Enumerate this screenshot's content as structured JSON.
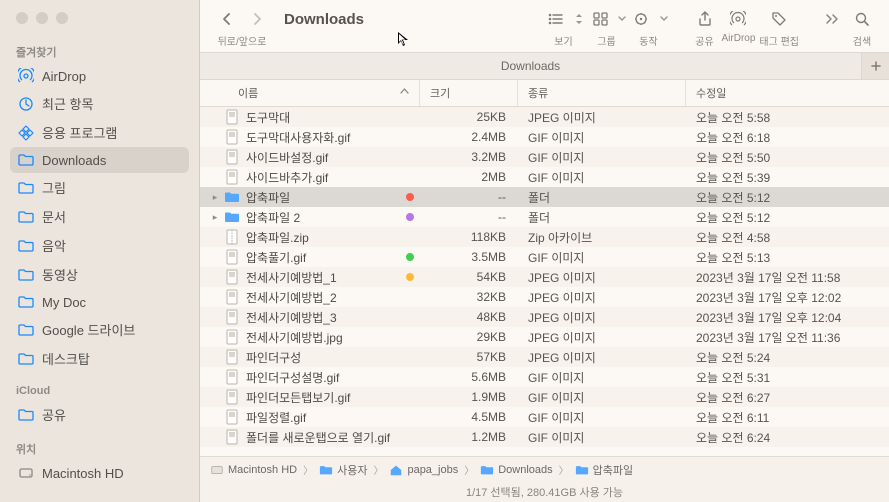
{
  "sidebar": {
    "sections": [
      {
        "title": "즐겨찾기",
        "items": [
          {
            "label": "AirDrop",
            "icon": "airdrop",
            "active": false
          },
          {
            "label": "최근 항목",
            "icon": "clock",
            "active": false
          },
          {
            "label": "응용 프로그램",
            "icon": "apps",
            "active": false
          },
          {
            "label": "Downloads",
            "icon": "folder",
            "active": true
          },
          {
            "label": "그림",
            "icon": "folder",
            "active": false
          },
          {
            "label": "문서",
            "icon": "folder",
            "active": false
          },
          {
            "label": "음악",
            "icon": "folder",
            "active": false
          },
          {
            "label": "동영상",
            "icon": "folder",
            "active": false
          },
          {
            "label": "My Doc",
            "icon": "folder",
            "active": false
          },
          {
            "label": "Google 드라이브",
            "icon": "folder",
            "active": false
          },
          {
            "label": "데스크탑",
            "icon": "folder",
            "active": false
          }
        ]
      },
      {
        "title": "iCloud",
        "items": [
          {
            "label": "공유",
            "icon": "folder",
            "active": false
          }
        ]
      },
      {
        "title": "위치",
        "items": [
          {
            "label": "Macintosh HD",
            "icon": "disk",
            "active": false
          }
        ]
      }
    ]
  },
  "toolbar": {
    "back_forward_label": "뒤로/앞으로",
    "title": "Downloads",
    "view_label": "보기",
    "group_label": "그룹",
    "action_label": "동작",
    "share_label": "공유",
    "airdrop_label": "AirDrop",
    "tagedit_label": "태그 편집",
    "search_label": "검색"
  },
  "tabs": {
    "current": "Downloads"
  },
  "columns": {
    "name": "이름",
    "size": "크기",
    "kind": "종류",
    "date": "수정일"
  },
  "rows": [
    {
      "name": "도구막대",
      "icon": "img",
      "size": "25KB",
      "kind": "JPEG 이미지",
      "date": "오늘 오전 5:58"
    },
    {
      "name": "도구막대사용자화.gif",
      "icon": "img",
      "size": "2.4MB",
      "kind": "GIF 이미지",
      "date": "오늘 오전 6:18"
    },
    {
      "name": "사이드바설정.gif",
      "icon": "img",
      "size": "3.2MB",
      "kind": "GIF 이미지",
      "date": "오늘 오전 5:50"
    },
    {
      "name": "사이드바추가.gif",
      "icon": "img",
      "size": "2MB",
      "kind": "GIF 이미지",
      "date": "오늘 오전 5:39"
    },
    {
      "name": "압축파일",
      "icon": "folder",
      "disclose": true,
      "selected": true,
      "tag": "#ff5c4d",
      "size": "--",
      "kind": "폴더",
      "date": "오늘 오전 5:12"
    },
    {
      "name": "압축파일 2",
      "icon": "folder",
      "disclose": true,
      "tag": "#b678e6",
      "size": "--",
      "kind": "폴더",
      "date": "오늘 오전 5:12"
    },
    {
      "name": "압축파일.zip",
      "icon": "zip",
      "size": "118KB",
      "kind": "Zip 아카이브",
      "date": "오늘 오전 4:58"
    },
    {
      "name": "압축풀기.gif",
      "icon": "img",
      "tag": "#40cf50",
      "size": "3.5MB",
      "kind": "GIF 이미지",
      "date": "오늘 오전 5:13"
    },
    {
      "name": "전세사기예방법_1",
      "icon": "img",
      "tag": "#ffb938",
      "size": "54KB",
      "kind": "JPEG 이미지",
      "date": "2023년 3월 17일 오전 11:58"
    },
    {
      "name": "전세사기예방법_2",
      "icon": "img",
      "size": "32KB",
      "kind": "JPEG 이미지",
      "date": "2023년 3월 17일 오후 12:02"
    },
    {
      "name": "전세사기예방법_3",
      "icon": "img",
      "size": "48KB",
      "kind": "JPEG 이미지",
      "date": "2023년 3월 17일 오후 12:04"
    },
    {
      "name": "전세사기예방법.jpg",
      "icon": "img",
      "size": "29KB",
      "kind": "JPEG 이미지",
      "date": "2023년 3월 17일 오전 11:36"
    },
    {
      "name": "파인더구성",
      "icon": "img",
      "size": "57KB",
      "kind": "JPEG 이미지",
      "date": "오늘 오전 5:24"
    },
    {
      "name": "파인더구성설명.gif",
      "icon": "img",
      "size": "5.6MB",
      "kind": "GIF 이미지",
      "date": "오늘 오전 5:31"
    },
    {
      "name": "파인더모든탭보기.gif",
      "icon": "img",
      "size": "1.9MB",
      "kind": "GIF 이미지",
      "date": "오늘 오전 6:27"
    },
    {
      "name": "파일정렬.gif",
      "icon": "img",
      "size": "4.5MB",
      "kind": "GIF 이미지",
      "date": "오늘 오전 6:11"
    },
    {
      "name": "폴더를 새로운탭으로 열기.gif",
      "icon": "img",
      "size": "1.2MB",
      "kind": "GIF 이미지",
      "date": "오늘 오전 6:24"
    }
  ],
  "path": [
    {
      "label": "Macintosh HD",
      "icon": "disk"
    },
    {
      "label": "사용자",
      "icon": "folder"
    },
    {
      "label": "papa_jobs",
      "icon": "home"
    },
    {
      "label": "Downloads",
      "icon": "folder"
    },
    {
      "label": "압축파일",
      "icon": "folder"
    }
  ],
  "status": "1/17 선택됨, 280.41GB 사용 가능"
}
